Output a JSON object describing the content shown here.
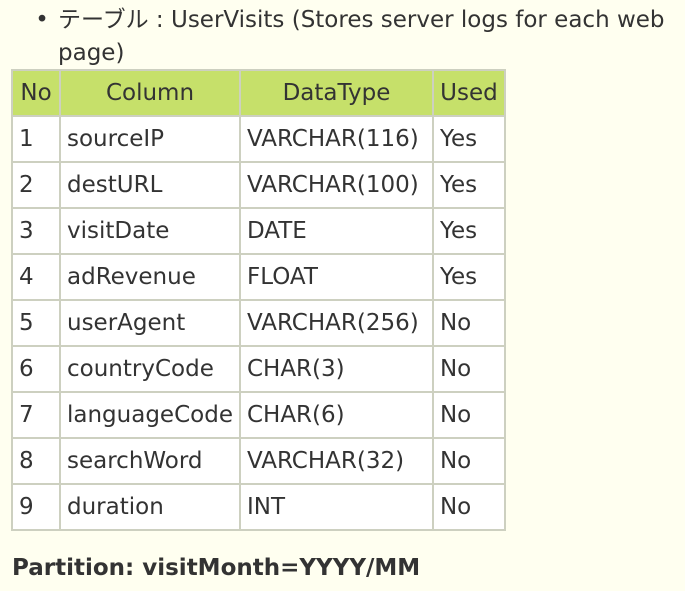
{
  "bullet": {
    "glyph": "•",
    "text": "テーブル : UserVisits (Stores server logs for each web page)"
  },
  "table": {
    "headers": [
      "No",
      "Column",
      "DataType",
      "Used"
    ],
    "rows": [
      [
        "1",
        "sourceIP",
        "VARCHAR(116)",
        "Yes"
      ],
      [
        "2",
        "destURL",
        "VARCHAR(100)",
        "Yes"
      ],
      [
        "3",
        "visitDate",
        "DATE",
        "Yes"
      ],
      [
        "4",
        "adRevenue",
        "FLOAT",
        "Yes"
      ],
      [
        "5",
        "userAgent",
        "VARCHAR(256)",
        "No"
      ],
      [
        "6",
        "countryCode",
        "CHAR(3)",
        "No"
      ],
      [
        "7",
        "languageCode",
        "CHAR(6)",
        "No"
      ],
      [
        "8",
        "searchWord",
        "VARCHAR(32)",
        "No"
      ],
      [
        "9",
        "duration",
        "INT",
        "No"
      ]
    ]
  },
  "partition": "Partition: visitMonth=YYYY/MM",
  "colors": {
    "header_bg": "#c6e06a",
    "page_bg": "#fffff0",
    "border": "#cdd0c0",
    "text": "#333333"
  }
}
